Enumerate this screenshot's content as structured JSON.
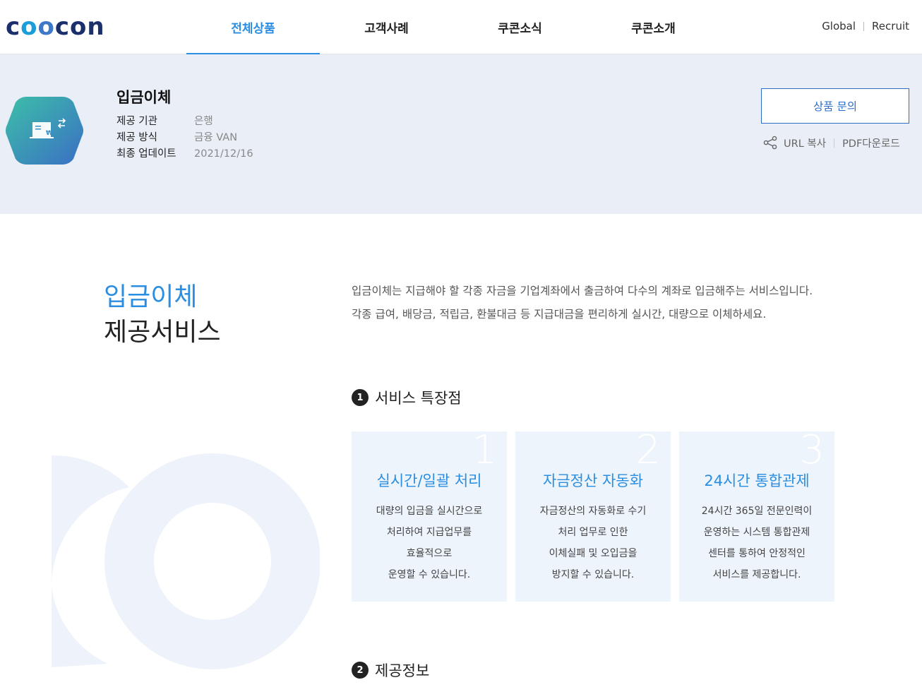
{
  "header": {
    "logo": {
      "c1": "c",
      "o1": "o",
      "o2": "o",
      "rest": "con"
    },
    "nav": [
      {
        "label": "전체상품",
        "active": true
      },
      {
        "label": "고객사례",
        "active": false
      },
      {
        "label": "쿠콘소식",
        "active": false
      },
      {
        "label": "쿠콘소개",
        "active": false
      }
    ],
    "util": {
      "global": "Global",
      "recruit": "Recruit"
    }
  },
  "banner": {
    "icon": "hexagon-transfer-icon",
    "title": "입금이체",
    "meta": [
      {
        "key": "제공 기관",
        "value": "은행"
      },
      {
        "key": "제공 방식",
        "value": "금융 VAN"
      },
      {
        "key": "최종 업데이트",
        "value": "2021/12/16"
      }
    ],
    "inquiry_label": "상품 문의",
    "url_copy": "URL 복사",
    "pdf_download": "PDF다운로드"
  },
  "main": {
    "side_title_1": "입금이체",
    "side_title_2": "제공서비스",
    "intro_1": "입금이체는 지급해야 할 각종 자금을 기업계좌에서 출금하여 다수의 계좌로 입금해주는 서비스입니다.",
    "intro_2": "각종 급여, 배당금, 적립금, 환불대금 등 지급대금을 편리하게 실시간, 대량으로 이체하세요.",
    "section1": {
      "num": "1",
      "title": "서비스 특장점"
    },
    "cards": [
      {
        "num": "1",
        "title": "실시간/일괄 처리",
        "lines": [
          "대량의 입금을 실시간으로",
          "처리하여 지급업무를",
          "효율적으로",
          "운영할 수 있습니다."
        ]
      },
      {
        "num": "2",
        "title": "자금정산 자동화",
        "lines": [
          "자금정산의 자동화로 수기",
          "처리 업무로 인한",
          "이체실패 및 오입금을",
          "방지할 수 있습니다."
        ]
      },
      {
        "num": "3",
        "title": "24시간 통합관제",
        "lines": [
          "24시간 365일 전문인력이",
          "운영하는 시스템 통합관제",
          "센터를 통하여 안정적인",
          "서비스를 제공합니다."
        ]
      }
    ],
    "section2": {
      "num": "2",
      "title": "제공정보"
    }
  },
  "colors": {
    "accent": "#2b8ee0",
    "banner_bg": "#e9eef7",
    "card_bg": "#eef4fc",
    "logo_navy": "#1a2f6b"
  }
}
